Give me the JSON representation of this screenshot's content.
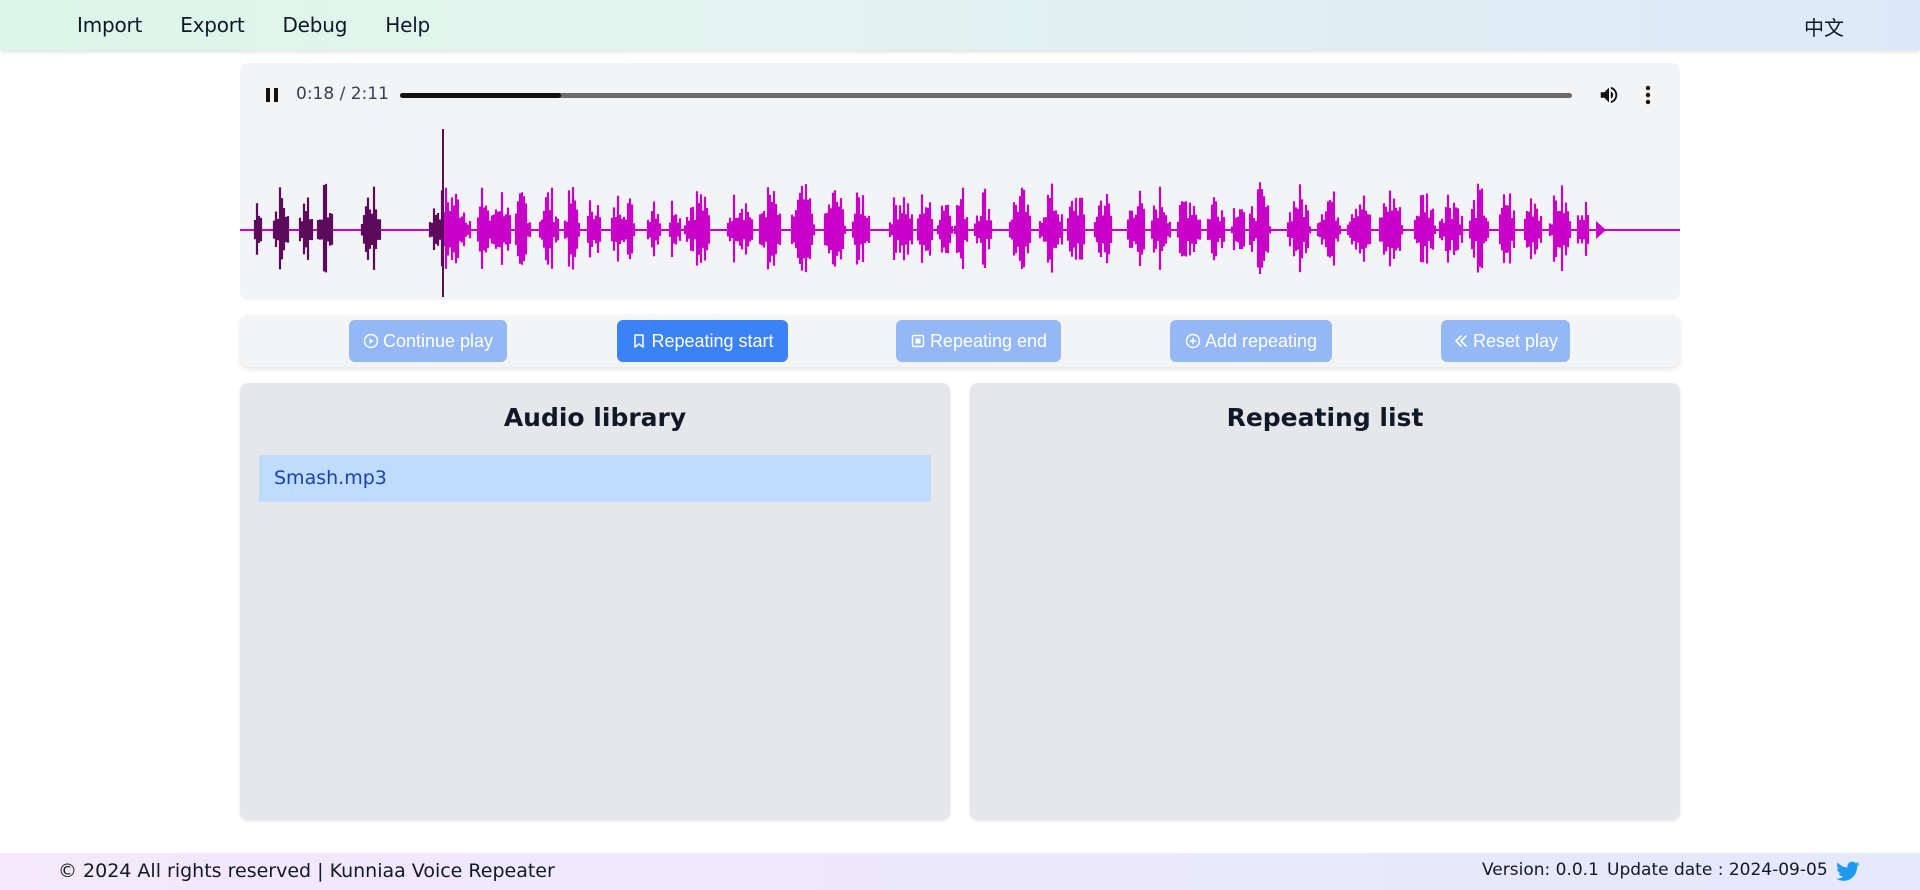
{
  "nav": {
    "items": [
      "Import",
      "Export",
      "Debug",
      "Help"
    ],
    "language": "中文"
  },
  "player": {
    "time": "0:18 / 2:11",
    "progress": 0.137,
    "icons": {
      "pause": "pause-icon",
      "volume": "volume-icon",
      "more": "more-vertical-icon"
    }
  },
  "waveform": {
    "played_color": "#5c0a5c",
    "unplayed_color": "#c800c8",
    "cursor_fraction": 0.137
  },
  "controls": {
    "continue_play": "Continue play",
    "repeating_start": "Repeating start",
    "repeating_end": "Repeating end",
    "add_repeating": "Add repeating",
    "reset_play": "Reset play"
  },
  "library": {
    "title": "Audio library",
    "items": [
      "Smash.mp3"
    ]
  },
  "repeating": {
    "title": "Repeating list"
  },
  "footer": {
    "copyright": "© 2024 All rights reserved | Kunniaa Voice Repeater",
    "version": "Version: 0.0.1",
    "update": "Update date : 2024-09-05",
    "social_icon": "twitter-icon"
  },
  "colors": {
    "button": "#93b8f5",
    "button_active": "#3b82f6",
    "library_item": "#bfdbfe"
  }
}
